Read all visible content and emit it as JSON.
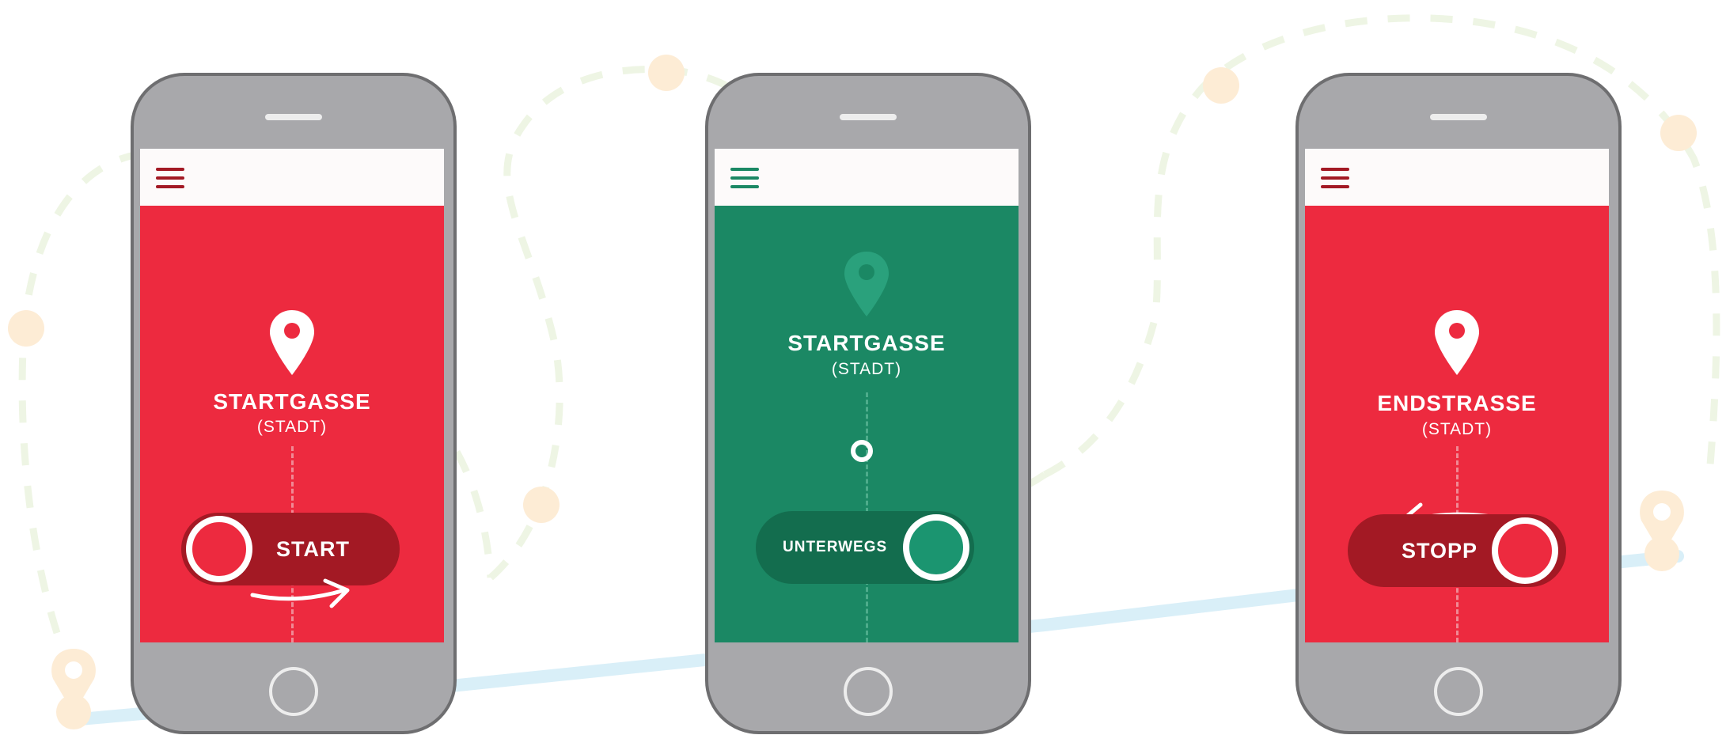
{
  "colors": {
    "red": "#ed2a3f",
    "red_dark": "#a31924",
    "green": "#1b8864",
    "green_dark": "#136d4e",
    "green_light": "#2aa17c",
    "phone_gray": "#a8a8ab",
    "phone_outline": "#6e6e70",
    "route_blue": "#d9eff8",
    "dash_green": "#eef5e4",
    "peach": "#fdecd5"
  },
  "icons": [
    "menu-icon",
    "location-pin-icon",
    "swipe-arrow-icon"
  ],
  "screens": [
    {
      "state": "start",
      "place": "STARTGASSE",
      "sub": "(STADT)",
      "action": "START"
    },
    {
      "state": "underway",
      "place": "STARTGASSE",
      "sub": "(STADT)",
      "action": "UNTERWEGS"
    },
    {
      "state": "stop",
      "place": "ENDSTRASSE",
      "sub": "(STADT)",
      "action": "STOPP"
    }
  ]
}
